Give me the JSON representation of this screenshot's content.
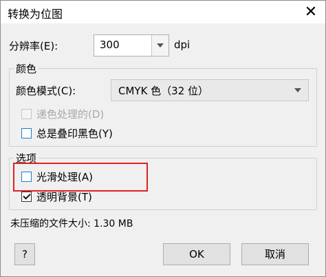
{
  "window": {
    "title": "转换为位图",
    "close_glyph": "✕"
  },
  "resolution": {
    "label": "分辨率(E):",
    "value": "300",
    "unit": "dpi"
  },
  "color_group": {
    "legend": "颜色",
    "mode_label": "颜色模式(C):",
    "mode_value": "CMYK 色（32 位）",
    "dither_label": "递色处理的(D)",
    "dither_checked": false,
    "dither_enabled": false,
    "overprint_label": "总是叠印黑色(Y)",
    "overprint_checked": false
  },
  "options_group": {
    "legend": "选项",
    "antialias_label": "光滑处理(A)",
    "antialias_checked": false,
    "transparent_label": "透明背景(T)",
    "transparent_checked": true
  },
  "uncompressed_size": "未压缩的文件大小: 1.30 MB",
  "buttons": {
    "help": "?",
    "ok": "OK",
    "cancel": "取消"
  },
  "colors": {
    "highlight_border": "#e02020",
    "checkbox_focus": "#1e7ad6"
  }
}
